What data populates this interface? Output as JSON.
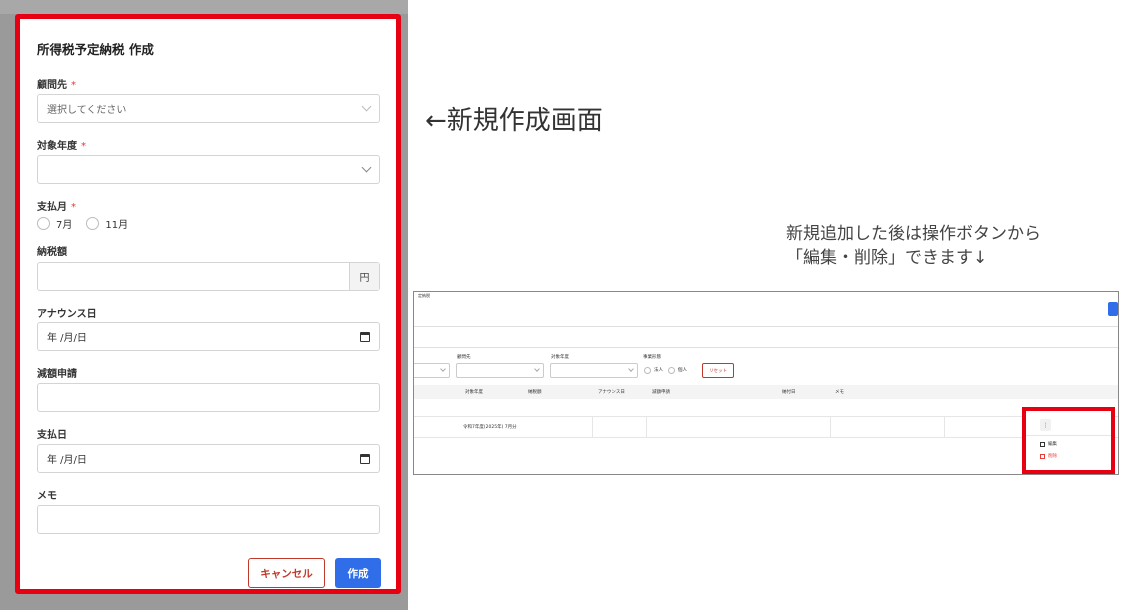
{
  "modal": {
    "title": "所得税予定納税 作成",
    "required_mark": "*",
    "fields": {
      "client": {
        "label": "顧問先",
        "placeholder": "選択してください"
      },
      "year": {
        "label": "対象年度",
        "value": ""
      },
      "month": {
        "label": "支払月",
        "options": [
          "7月",
          "11月"
        ]
      },
      "amount": {
        "label": "納税額",
        "unit": "円",
        "value": ""
      },
      "announce": {
        "label": "アナウンス日",
        "value": "年 /月/日"
      },
      "reduction": {
        "label": "減額申請",
        "value": ""
      },
      "paydate": {
        "label": "支払日",
        "value": "年 /月/日"
      },
      "memo": {
        "label": "メモ",
        "value": ""
      }
    },
    "buttons": {
      "cancel": "キャンセル",
      "create": "作成"
    }
  },
  "captions": {
    "new_screen": "←新規作成画面",
    "after_add": "新規追加した後は操作ボタンから\n「編集・削除」できます↓"
  },
  "list": {
    "title": "定納税",
    "filters": {
      "client_label": "顧問先",
      "year_label": "対象年度",
      "type_label": "事業形態",
      "radio_options": [
        "法人",
        "個人"
      ],
      "reset": "リセット"
    },
    "columns": [
      "対象年度",
      "納税額",
      "アナウンス日",
      "減額申請",
      "納付日",
      "メモ"
    ],
    "row": {
      "year": "令和7年度(2025年) 7月分"
    },
    "menu": {
      "kebab": "⋮",
      "edit": "編集",
      "delete": "削除"
    }
  },
  "colors": {
    "highlight": "#e60012",
    "primary": "#2f6ee8",
    "danger": "#c0392b"
  }
}
